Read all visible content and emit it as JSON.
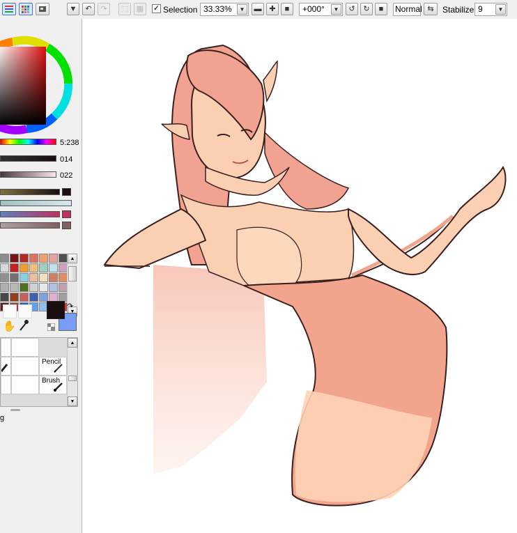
{
  "toolbar": {
    "selection_label": "Selection",
    "selection_checked": true,
    "zoom_value": "33.33%",
    "rotation_value": "+000°",
    "blend_mode": "Normal",
    "stabilizer_label": "Stabilizer",
    "stabilizer_value": "9"
  },
  "color_panel": {
    "hue_value": "5:238",
    "sat_value": "014",
    "val_value": "022",
    "main_color": "#1a0e10",
    "sub_color": "#7a9ef8"
  },
  "swatches": [
    "#8c8c8c",
    "#7a1414",
    "#b82820",
    "#e07060",
    "#f0a070",
    "#e8a0a0",
    "#505050",
    "#d8d8d8",
    "#c82020",
    "#f0a030",
    "#f0c080",
    "#a0d0c0",
    "#c0e0f0",
    "#d0a0c0",
    "#909090",
    "#707070",
    "#88d0e0",
    "#e8c0a0",
    "#f0e0c0",
    "#d08060",
    "#e09060",
    "#b0b0b0",
    "#b8b8b8",
    "#507020",
    "#d0d0d0",
    "#e8e8e8",
    "#b0c0e0",
    "#c0a0b0",
    "#484848",
    "#904020",
    "#c86060",
    "#4060b0",
    "#80a0e0",
    "#e0b0d0",
    "#a0a0a0",
    "#602020",
    "#a04040",
    "#2060d0",
    "#60a0f0",
    "#90c0f0",
    "#b0a0c0",
    "#c04040"
  ],
  "tools": {
    "pencil_label": "Pencil",
    "brush_label": "Brush",
    "partial_label": "g"
  },
  "icons": {
    "undo": "undo-icon",
    "redo": "redo-icon",
    "hand": "hand-icon",
    "eyedropper": "eyedropper-icon"
  }
}
